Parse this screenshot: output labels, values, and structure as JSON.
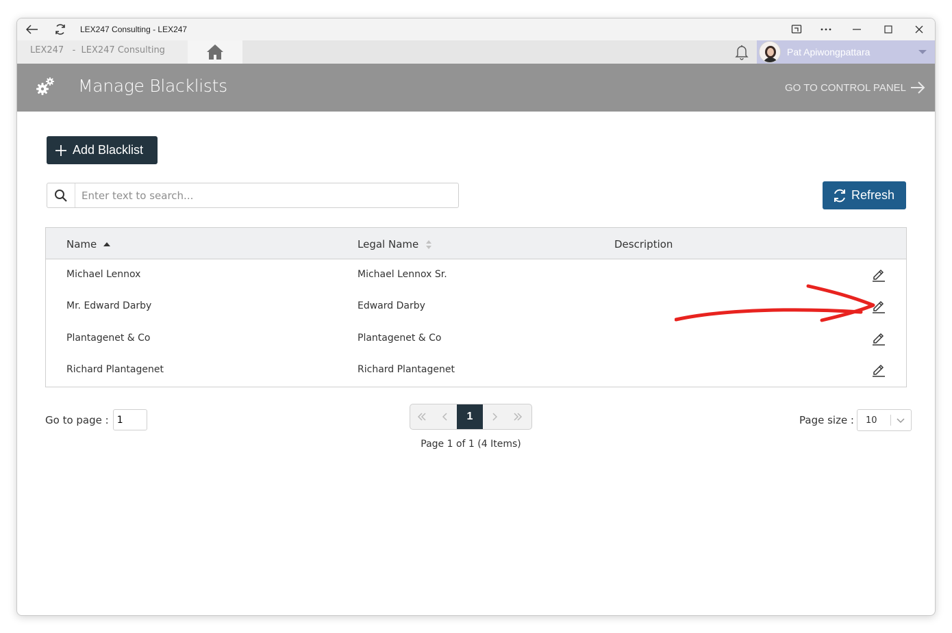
{
  "window": {
    "title": "LEX247 Consulting - LEX247"
  },
  "appbar": {
    "company": "LEX247   -  LEX247 Consulting",
    "user_name": "Pat Apiwongpattara"
  },
  "header": {
    "title": "Manage Blacklists",
    "control_panel_link": "GO TO CONTROL PANEL"
  },
  "toolbar": {
    "add_label": "Add Blacklist",
    "refresh_label": "Refresh"
  },
  "search": {
    "placeholder": "Enter text to search..."
  },
  "grid": {
    "columns": [
      "Name",
      "Legal Name",
      "Description"
    ],
    "rows": [
      {
        "name": "Michael Lennox",
        "legal_name": "Michael Lennox Sr.",
        "description": ""
      },
      {
        "name": "Mr. Edward Darby",
        "legal_name": "Edward Darby",
        "description": ""
      },
      {
        "name": "Plantagenet & Co",
        "legal_name": "Plantagenet & Co",
        "description": ""
      },
      {
        "name": "Richard Plantagenet",
        "legal_name": "Richard Plantagenet",
        "description": ""
      }
    ]
  },
  "pager": {
    "goto_label": "Go to page :",
    "goto_value": "1",
    "current_page": "1",
    "info": "Page 1 of 1 (4 Items)",
    "page_size_label": "Page size :",
    "page_size_value": "10"
  },
  "colors": {
    "header_bg": "#939393",
    "primary_dark": "#23343f",
    "refresh_blue": "#1f5d8c",
    "user_bar": "#c6c8e4",
    "annotation_red": "#e8231f"
  }
}
